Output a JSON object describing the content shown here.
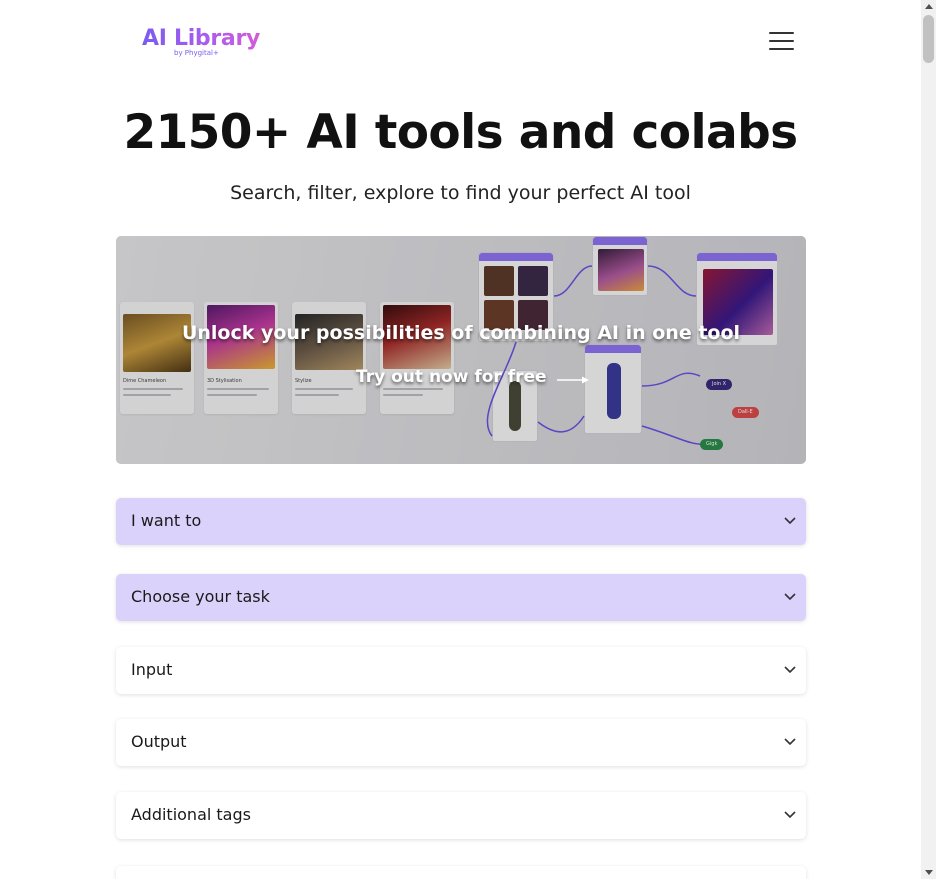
{
  "header": {
    "logo_text": "AI Library",
    "logo_subtext": "by Phygital+",
    "menu_icon": "hamburger-menu-icon"
  },
  "hero": {
    "title": "2150+ AI tools and colabs",
    "subtitle": "Search, filter, explore to find your perfect AI tool"
  },
  "banner": {
    "headline": "Unlock your possibilities of combining AI in one tool",
    "cta": "Try out now for free",
    "card_captions": [
      "Dime Chameleon",
      "3D Stylisation",
      "Stylize",
      ""
    ],
    "pill_labels": [
      "Join X",
      "Dall-E",
      "Gigk"
    ]
  },
  "filters": [
    {
      "label": "I want to",
      "state": "active"
    },
    {
      "label": "Choose your task",
      "state": "active"
    },
    {
      "label": "Input",
      "state": "default"
    },
    {
      "label": "Output",
      "state": "default"
    },
    {
      "label": "Additional tags",
      "state": "default"
    }
  ],
  "colors": {
    "accent": "#dbd2fb",
    "logo_gradient_start": "#7b5cf0",
    "logo_gradient_end": "#d35bd8",
    "title": "#111111"
  }
}
